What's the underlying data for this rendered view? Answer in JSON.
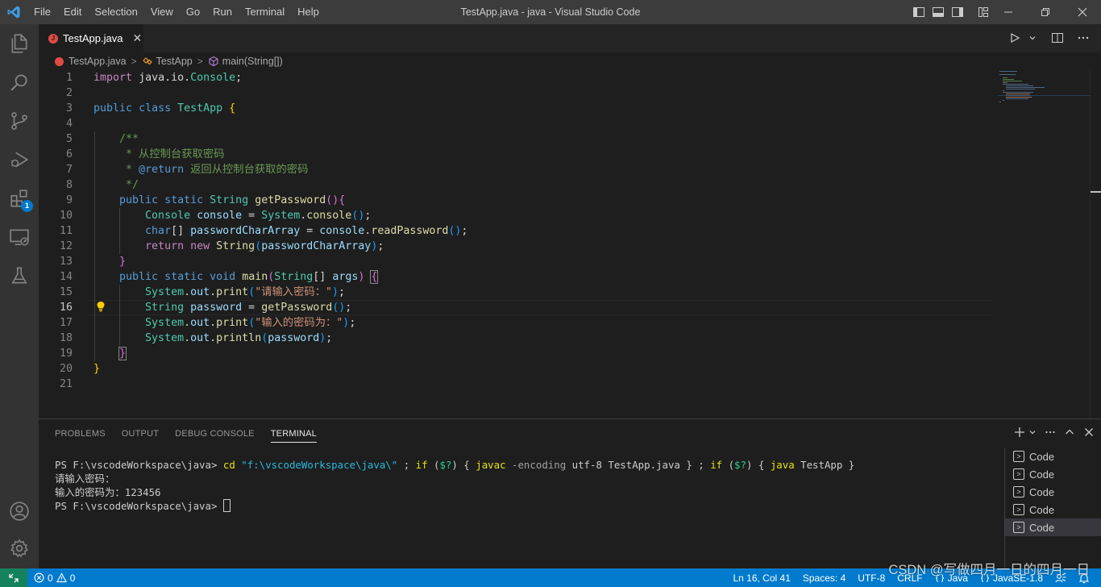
{
  "window": {
    "title": "TestApp.java - java - Visual Studio Code",
    "menu": [
      "File",
      "Edit",
      "Selection",
      "View",
      "Go",
      "Run",
      "Terminal",
      "Help"
    ]
  },
  "activity_bar": {
    "items": [
      "explorer-icon",
      "search-icon",
      "source-control-icon",
      "run-debug-icon",
      "extensions-icon",
      "remote-explorer-icon",
      "testing-icon"
    ],
    "extensions_badge": "1",
    "bottom_items": [
      "accounts-icon",
      "manage-gear-icon"
    ]
  },
  "tab": {
    "label": "TestApp.java",
    "icon_letter": "J",
    "close": "✕"
  },
  "breadcrumbs": [
    {
      "label": "TestApp.java",
      "icon": "java-file-icon"
    },
    {
      "label": "TestApp",
      "icon": "class-icon"
    },
    {
      "label": "main(String[])",
      "icon": "method-icon"
    }
  ],
  "editor": {
    "language": "java",
    "active_line": 16,
    "line_numbers": [
      "1",
      "2",
      "3",
      "4",
      "5",
      "6",
      "7",
      "8",
      "9",
      "10",
      "11",
      "12",
      "13",
      "14",
      "15",
      "16",
      "17",
      "18",
      "19",
      "20",
      "21"
    ],
    "lines": [
      "import java.io.Console;",
      "",
      "public class TestApp {",
      "",
      "    /**",
      "     * 从控制台获取密码",
      "     * @return 返回从控制台获取的密码",
      "     */",
      "    public static String getPassword(){",
      "        Console console = System.console();",
      "        char[] passwordCharArray = console.readPassword();",
      "        return new String(passwordCharArray);",
      "    }",
      "    public static void main(String[] args) {",
      "        System.out.print(\"请输入密码：\");",
      "        String password = getPassword();",
      "        System.out.print(\"输入的密码为：\");",
      "        System.out.println(password);",
      "    }",
      "}",
      ""
    ]
  },
  "panel": {
    "tabs": [
      "PROBLEMS",
      "OUTPUT",
      "DEBUG CONSOLE",
      "TERMINAL"
    ],
    "active_tab": "TERMINAL",
    "terminal_lines": [
      "PS F:\\vscodeWorkspace\\java> cd \"f:\\vscodeWorkspace\\java\\\" ; if ($?) { javac -encoding utf-8 TestApp.java } ; if ($?) { java TestApp }",
      "请输入密码：",
      "输入的密码为：123456",
      "PS F:\\vscodeWorkspace\\java> "
    ],
    "terminal_instances": [
      "Code",
      "Code",
      "Code",
      "Code",
      "Code"
    ],
    "active_instance": 4
  },
  "status_bar": {
    "errors": "0",
    "warnings": "0",
    "position": "Ln 16, Col 41",
    "indent": "Spaces: 4",
    "encoding": "UTF-8",
    "eol": "CRLF",
    "language": "Java",
    "runtime": "JavaSE-1.8"
  },
  "watermark": "CSDN @写做四月一日的四月一日",
  "colors": {
    "status_bar": "#007acc",
    "remote": "#16825d",
    "activity_bar": "#333333",
    "title_bar": "#3c3c3c",
    "editor_bg": "#1e1e1e",
    "keyword": "#569cd6",
    "control_keyword": "#c586c0",
    "type": "#4ec9b0",
    "function": "#dcdcaa",
    "variable": "#9cdcfe",
    "string": "#ce9178",
    "comment": "#6a9955"
  }
}
